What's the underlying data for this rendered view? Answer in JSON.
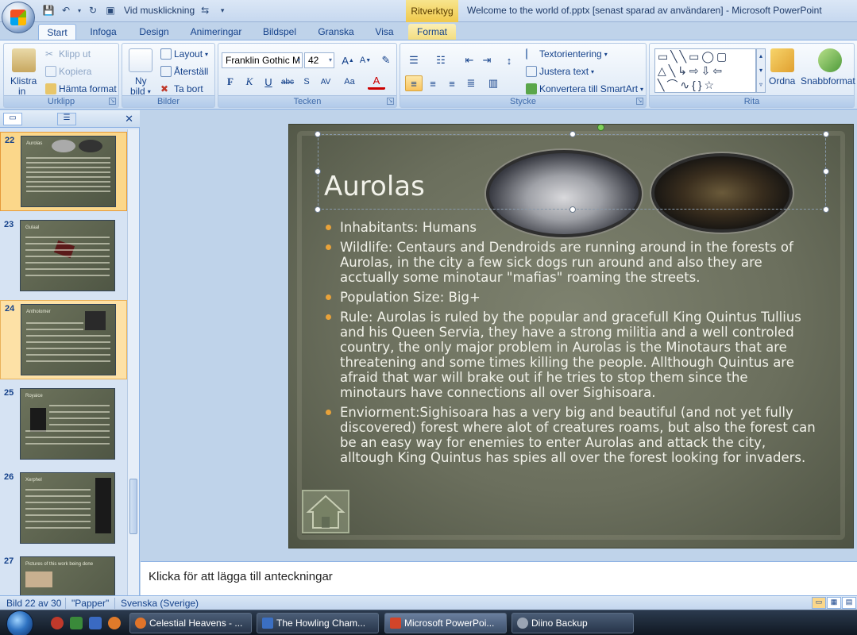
{
  "app": {
    "quick_access_label": "Vid musklickning",
    "contextual_tab": "Ritverktyg",
    "window_title": "Welcome to the world of.pptx [senast sparad av användaren] - Microsoft PowerPoint"
  },
  "tabs": [
    "Start",
    "Infoga",
    "Design",
    "Animeringar",
    "Bildspel",
    "Granska",
    "Visa",
    "Format"
  ],
  "ribbon": {
    "clipboard": {
      "group_label": "Urklipp",
      "paste": "Klistra",
      "paste_sub": "in",
      "cut": "Klipp ut",
      "copy": "Kopiera",
      "format_painter": "Hämta format"
    },
    "slides": {
      "group_label": "Bilder",
      "new_slide": "Ny",
      "new_slide_sub": "bild",
      "layout": "Layout",
      "reset": "Återställ",
      "delete": "Ta bort"
    },
    "font": {
      "group_label": "Tecken",
      "font_name": "Franklin Gothic M",
      "font_size": "42"
    },
    "paragraph": {
      "group_label": "Stycke",
      "text_direction": "Textorientering",
      "align_text": "Justera text",
      "convert_smartart": "Konvertera till SmartArt"
    },
    "drawing": {
      "group_label": "Rita",
      "arrange": "Ordna",
      "quick_styles": "Snabbformat"
    }
  },
  "thumbnails": [
    {
      "num": "22",
      "title": "Aurolas"
    },
    {
      "num": "23",
      "title": "Gulaal"
    },
    {
      "num": "24",
      "title": "Antholomer"
    },
    {
      "num": "25",
      "title": "Royaice"
    },
    {
      "num": "26",
      "title": "Xerphel"
    },
    {
      "num": "27",
      "title": "Pictures of this work being done"
    }
  ],
  "slide": {
    "title": "Aurolas",
    "bullets": [
      "Inhabitants: Humans",
      "Wildlife: Centaurs and Dendroids are running around in the forests of Aurolas, in the city a few sick dogs run around and also they are acctually some minotaur \"mafias\" roaming the streets.",
      "Population Size: Big+",
      "Rule: Aurolas is ruled by the popular and gracefull King Quintus Tullius and his Queen Servia, they have a strong militia and a well controled country, the only major problem in Aurolas is the Minotaurs that are threatening and some times killing the people. Allthough Quintus are afraid that war will brake out if he tries to stop them since the minotaurs have connections all over Sighisoara.",
      "Enviorment:Sighisoara has a very big and beautiful (and not yet fully discovered) forest where alot of creatures roams, but also the forest can be an easy way for enemies to enter Aurolas and attack the city, alltough King Quintus has spies all over the forest looking for invaders."
    ]
  },
  "notes_placeholder": "Klicka för att lägga till anteckningar",
  "status": {
    "slide_position": "Bild 22 av 30",
    "theme": "\"Papper\"",
    "language": "Svenska (Sverige)"
  },
  "taskbar": [
    {
      "label": "Celestial Heavens - ...",
      "color": "#e0742a"
    },
    {
      "label": "The Howling Cham...",
      "color": "#3b6fc2"
    },
    {
      "label": "Microsoft PowerPoi...",
      "color": "#d2452a"
    },
    {
      "label": "Diino Backup",
      "color": "#9aa4b3"
    }
  ]
}
